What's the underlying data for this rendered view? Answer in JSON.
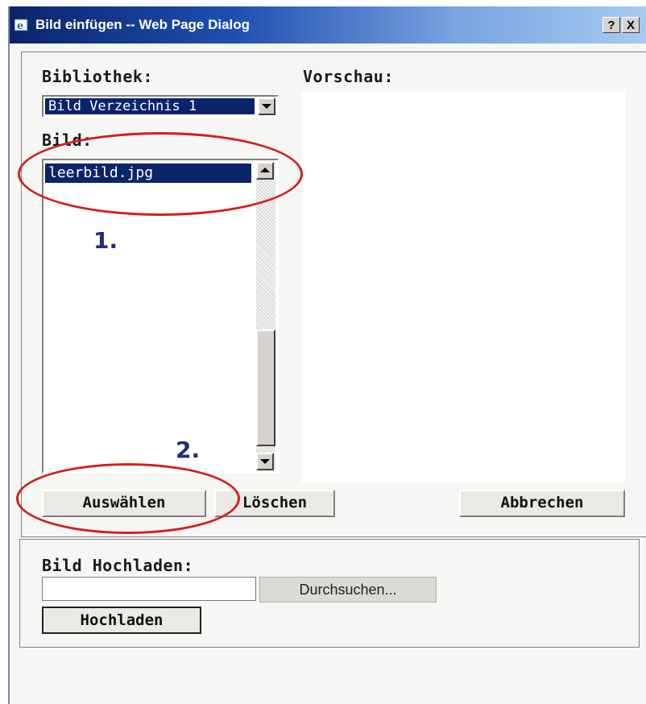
{
  "window": {
    "title": "Bild einfügen -- Web Page Dialog",
    "help_label": "?",
    "close_label": "X"
  },
  "library": {
    "label": "Bibliothek:",
    "selected": "Bild Verzeichnis 1"
  },
  "image": {
    "label": "Bild:",
    "items": [
      "leerbild.jpg"
    ]
  },
  "preview": {
    "label": "Vorschau:"
  },
  "buttons": {
    "select": "Auswählen",
    "delete": "Löschen",
    "cancel": "Abbrechen"
  },
  "upload": {
    "label": "Bild Hochladen:",
    "file_value": "",
    "browse": "Durchsuchen...",
    "upload": "Hochladen"
  },
  "annotations": {
    "step1": "1.",
    "step2": "2.",
    "highlight_color": "#d11f1f"
  }
}
